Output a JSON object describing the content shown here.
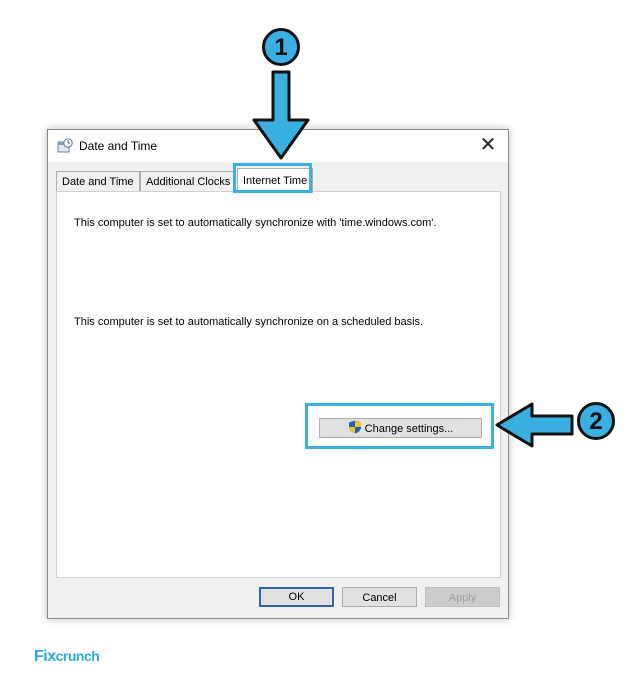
{
  "window": {
    "title": "Date and Time",
    "close_label": "✕"
  },
  "tabs": [
    {
      "label": "Date and Time",
      "active": false
    },
    {
      "label": "Additional Clocks",
      "active": false
    },
    {
      "label": "Internet Time",
      "active": true
    }
  ],
  "content": {
    "sync_message": "This computer is set to automatically synchronize with 'time.windows.com'.",
    "schedule_message": "This computer is set to automatically synchronize on a scheduled basis.",
    "change_settings_label": "Change settings..."
  },
  "footer": {
    "ok_label": "OK",
    "cancel_label": "Cancel",
    "apply_label": "Apply"
  },
  "annotations": {
    "step1": "1",
    "step2": "2",
    "highlight_color": "#3ab0e2"
  },
  "brand": {
    "logo_fix": "Fix",
    "logo_crunch": "crunch"
  }
}
